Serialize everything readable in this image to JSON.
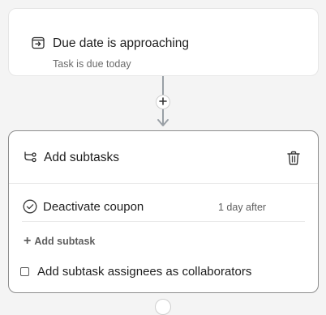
{
  "trigger": {
    "icon": "calendar-arrow-icon",
    "title": "Due date is approaching",
    "subtitle": "Task is due today"
  },
  "connector": {
    "add_icon": "plus-icon"
  },
  "action": {
    "icon": "subtasks-branch-icon",
    "title": "Add subtasks",
    "delete_icon": "trash-icon",
    "subtasks": [
      {
        "icon": "check-circle-icon",
        "name": "Deactivate coupon",
        "timing": "1 day after"
      }
    ],
    "add_subtask_label": "Add subtask",
    "collaborators_checkbox": {
      "label": "Add subtask assignees as collaborators",
      "checked": false
    }
  },
  "colors": {
    "background": "#f4f4f4",
    "card": "#ffffff",
    "connector": "#9aa0a6",
    "selected_border": "#8c8c8c"
  }
}
